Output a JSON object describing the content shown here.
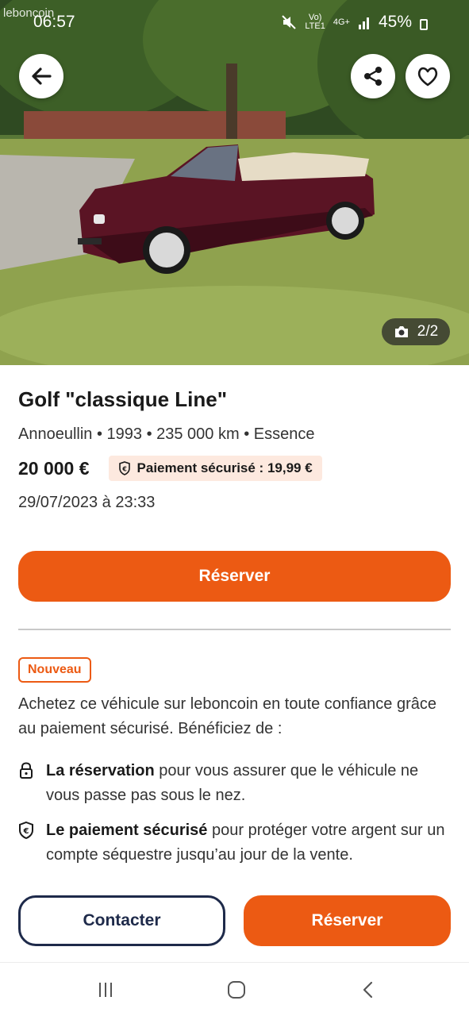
{
  "status_bar": {
    "time": "06:57",
    "logo_overlay": "leboncoin",
    "network_top": "Vo)",
    "network_bottom": "LTE1",
    "network_type": "4G+",
    "battery": "45%"
  },
  "photo": {
    "counter": "2/2"
  },
  "listing": {
    "title": "Golf \"classique Line\"",
    "meta": "Annoeullin • 1993 • 235 000 km • Essence",
    "price": "20 000 €",
    "secure_payment": "Paiement sécurisé : 19,99 €",
    "date": "29/07/2023 à 23:33"
  },
  "primary_action": {
    "label": "Réserver"
  },
  "promo": {
    "badge": "Nouveau",
    "intro": "Achetez ce véhicule sur leboncoin en toute confiance grâce au paiement sécurisé. Bénéficiez de :",
    "benefits": [
      {
        "icon": "lock-icon",
        "bold": "La réservation",
        "text": " pour vous assurer que le véhicule ne vous passe pas sous le nez."
      },
      {
        "icon": "euro-shield-icon",
        "bold": "Le paiement sécurisé",
        "text": " pour protéger votre argent sur un compte séquestre jusqu’au jour de la vente."
      }
    ]
  },
  "bottom_actions": {
    "contact": "Contacter",
    "reserve": "Réserver"
  },
  "colors": {
    "accent": "#ec5a13",
    "navy": "#1e2a4a",
    "badge_bg": "#fde9df"
  }
}
